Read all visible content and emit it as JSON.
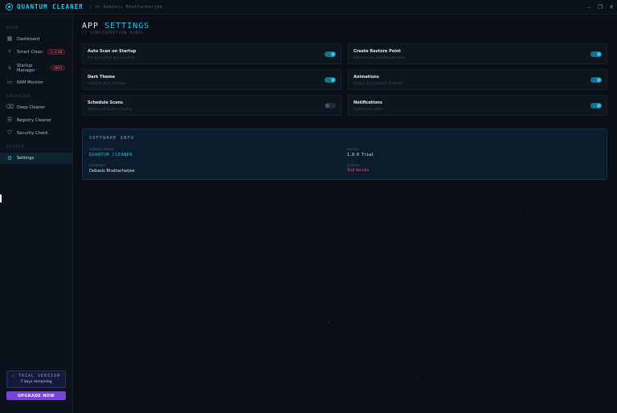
{
  "titlebar": {
    "app_name": "QUANTUM CLEANER",
    "separator": "|",
    "subtitle": "vs Debasis Bhattacharjee",
    "minimize": "–",
    "maximize": "❐",
    "close": "✕"
  },
  "sidebar": {
    "sections": {
      "main": "MAIN",
      "advanced": "ADVANCED",
      "system": "SYSTEM"
    },
    "items": [
      {
        "label": "Dashboard",
        "icon": "grid-icon"
      },
      {
        "label": "Smart Clean",
        "icon": "sparkle-icon",
        "badge": "2.3 GB"
      },
      {
        "label": "Startup\nManager",
        "icon": "bolt-icon",
        "badge": "4034"
      },
      {
        "label": "RAM Monitor",
        "icon": "memory-icon"
      },
      {
        "label": "Deep Cleaner",
        "icon": "trash-icon"
      },
      {
        "label": "Registry Cleaner",
        "icon": "list-icon"
      },
      {
        "label": "Security Check",
        "icon": "shield-icon"
      },
      {
        "label": "Settings",
        "icon": "gear-icon",
        "active": true
      }
    ],
    "trial": {
      "title": "⚠ TRIAL VERSION",
      "days": "7 days remaining"
    },
    "upgrade_label": "UPGRADE NOW"
  },
  "main": {
    "title_plain": "APP ",
    "title_accent": "SETTINGS",
    "subtitle": "// CONFIGURATION PANEL",
    "settings": [
      {
        "name": "Auto Scan on Startup",
        "desc": "Run scan when app launches",
        "on": true
      },
      {
        "name": "Create Restore Point",
        "desc": "Before every cleaning operation",
        "on": true
      },
      {
        "name": "Dark Theme",
        "desc": "Futuristic dark interface",
        "on": true
      },
      {
        "name": "Animations",
        "desc": "Enable UI animations & effects",
        "on": true
      },
      {
        "name": "Schedule Scans",
        "desc": "Weekly automatic scanning",
        "on": false
      },
      {
        "name": "Notifications",
        "desc": "System tray alerts",
        "on": true
      }
    ],
    "software_info": {
      "title": "SOFTWARE INFO",
      "software_name_label": "Software Name",
      "software_name": "QUANTUM CLEANER",
      "version_label": "Version",
      "version": "1.0.0 Trial",
      "developer_label": "Developer",
      "developer": "Debasis Bhattacharjee",
      "license_label": "License",
      "license": "Trial Version"
    }
  },
  "colors": {
    "accent": "#2cc7ea",
    "background": "#0a0f17",
    "upgrade": "#7b3fe0",
    "danger": "#ff5d6c"
  }
}
